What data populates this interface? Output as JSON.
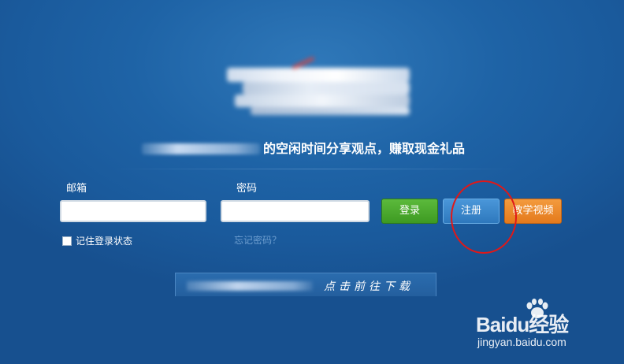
{
  "header": {
    "tagline": "的空闲时间分享观点，赚取现金礼品"
  },
  "login_form": {
    "email_label": "邮箱",
    "password_label": "密码",
    "email_value": "",
    "password_value": "",
    "login_label": "登录",
    "register_label": "注册",
    "video_label": "教学视频",
    "remember_label": "记住登录状态",
    "remember_checked": false,
    "forgot_label": "忘记密码？"
  },
  "download": {
    "label": "点击前往下载"
  },
  "watermark": {
    "brand": "Baidu经验",
    "url": "jingyan.baidu.com"
  },
  "colors": {
    "background": "#1e63a6",
    "login_button": "#4aa82e",
    "register_button": "#3a86cb",
    "video_button": "#ec8a2b",
    "annotation_circle": "#e01818"
  },
  "icons": {
    "logo": "blurred-logo",
    "watermark": "baidu-paw-icon"
  }
}
